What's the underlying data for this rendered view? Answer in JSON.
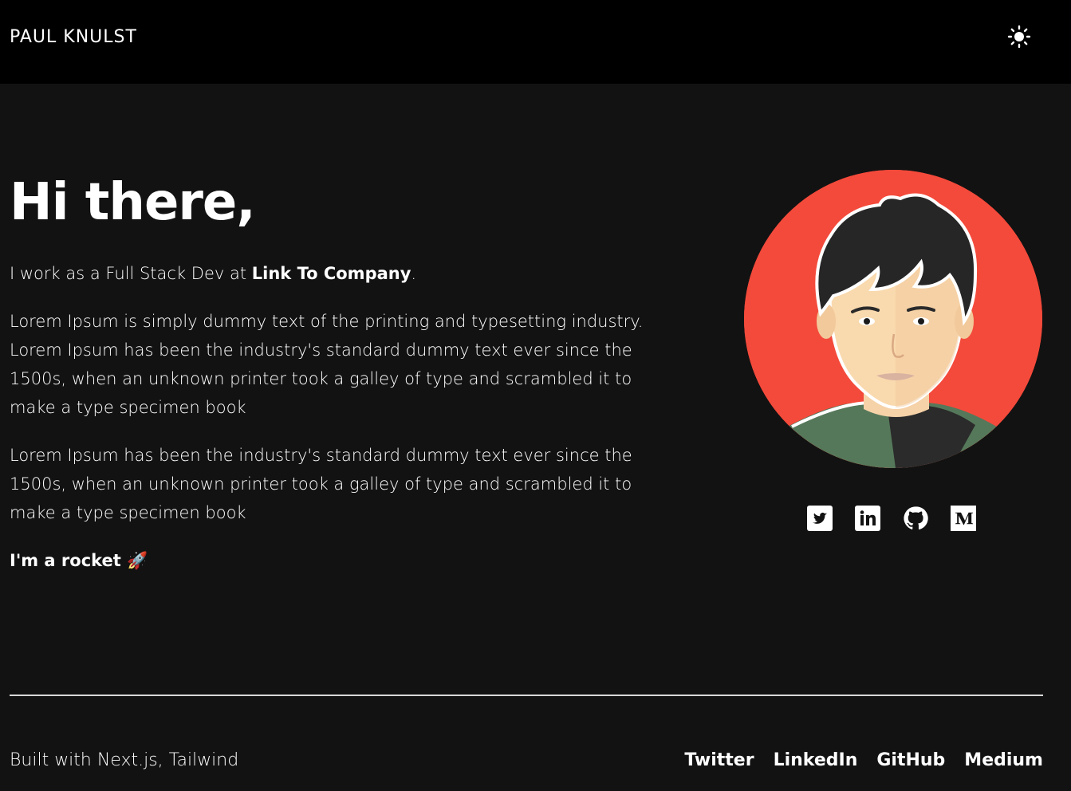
{
  "header": {
    "brand": "PAUL KNULST",
    "theme_icon": "sun-icon"
  },
  "hero": {
    "title": "Hi there,",
    "intro_prefix": "I work as a Full Stack Dev at ",
    "company_link": "Link To Company",
    "intro_suffix": ".",
    "paragraph1": "Lorem Ipsum is simply dummy text of the printing and typesetting industry. Lorem Ipsum has been the industry's standard dummy text ever since the 1500s, when an unknown printer took a galley of type and scrambled it to make a type specimen book",
    "paragraph2": "Lorem Ipsum has been the industry's standard dummy text ever since the 1500s, when an unknown printer took a galley of type and scrambled it to make a type specimen book",
    "tagline": "I'm a rocket 🚀"
  },
  "avatar": {
    "background": "#f44a3b"
  },
  "socials": [
    {
      "icon": "twitter-icon"
    },
    {
      "icon": "linkedin-icon"
    },
    {
      "icon": "github-icon"
    },
    {
      "icon": "medium-icon"
    }
  ],
  "footer": {
    "built_with": "Built with Next.js, Tailwind",
    "links": [
      "Twitter",
      "LinkedIn",
      "GitHub",
      "Medium"
    ]
  }
}
